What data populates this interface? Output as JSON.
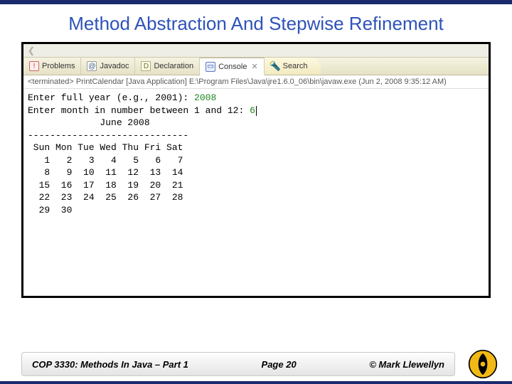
{
  "slide": {
    "title": "Method Abstraction And Stepwise Refinement"
  },
  "tabs": {
    "problems": "Problems",
    "javadoc": "Javadoc",
    "declaration": "Declaration",
    "console": "Console",
    "search": "Search"
  },
  "status": "<terminated> PrintCalendar [Java Application] E:\\Program Files\\Java\\jre1.6.0_06\\bin\\javaw.exe (Jun 2, 2008 9:35:12 AM)",
  "console": {
    "prompt_year": "Enter full year (e.g., 2001): ",
    "input_year": "2008",
    "prompt_month": "Enter month in number between 1 and 12: ",
    "input_month": "6",
    "cal_title": "             June 2008",
    "rule": "-----------------------------",
    "dow": " Sun Mon Tue Wed Thu Fri Sat",
    "w1": "   1   2   3   4   5   6   7",
    "w2": "   8   9  10  11  12  13  14",
    "w3": "  15  16  17  18  19  20  21",
    "w4": "  22  23  24  25  26  27  28",
    "w5": "  29  30"
  },
  "footer": {
    "left": "COP 3330:  Methods In Java – Part 1",
    "mid": "Page 20",
    "right": "© Mark Llewellyn"
  },
  "chart_data": {
    "type": "table",
    "title": "June 2008",
    "columns": [
      "Sun",
      "Mon",
      "Tue",
      "Wed",
      "Thu",
      "Fri",
      "Sat"
    ],
    "rows": [
      [
        1,
        2,
        3,
        4,
        5,
        6,
        7
      ],
      [
        8,
        9,
        10,
        11,
        12,
        13,
        14
      ],
      [
        15,
        16,
        17,
        18,
        19,
        20,
        21
      ],
      [
        22,
        23,
        24,
        25,
        26,
        27,
        28
      ],
      [
        29,
        30,
        null,
        null,
        null,
        null,
        null
      ]
    ],
    "inputs": {
      "year": 2008,
      "month": 6
    }
  }
}
